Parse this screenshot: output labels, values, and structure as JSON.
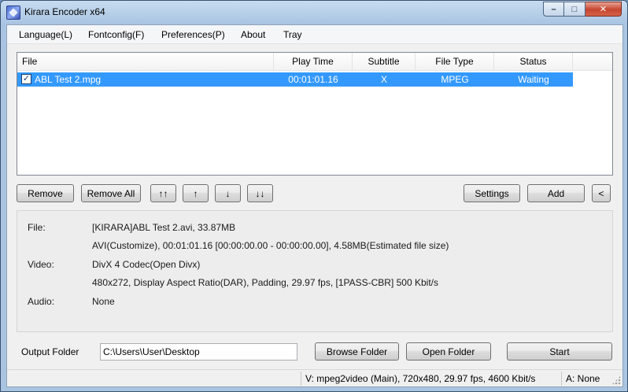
{
  "window": {
    "title": "Kirara Encoder x64",
    "controls": {
      "minimize": "–",
      "maximize": "□",
      "close": "✕"
    }
  },
  "menu": [
    {
      "label": "Language(L)"
    },
    {
      "label": "Fontconfig(F)"
    },
    {
      "label": "Preferences(P)"
    },
    {
      "label": "About"
    },
    {
      "label": "Tray"
    }
  ],
  "file_list": {
    "columns": [
      "File",
      "Play Time",
      "Subtitle",
      "File Type",
      "Status"
    ],
    "rows": [
      {
        "checked": true,
        "file": "ABL Test 2.mpg",
        "play_time": "00:01:01.16",
        "subtitle": "X",
        "file_type": "MPEG",
        "status": "Waiting"
      }
    ]
  },
  "toolbar": {
    "remove": "Remove",
    "remove_all": "Remove All",
    "move_top": "↑↑",
    "move_up": "↑",
    "move_down": "↓",
    "move_bottom": "↓↓",
    "settings": "Settings",
    "add": "Add",
    "collapse": "<"
  },
  "info": {
    "file_label": "File:",
    "file_line1": "[KIRARA]ABL Test 2.avi, 33.87MB",
    "file_line2": "AVI(Customize), 00:01:01.16 [00:00:00.00 - 00:00:00.00], 4.58MB(Estimated file size)",
    "video_label": "Video:",
    "video_line1": "DivX 4 Codec(Open Divx)",
    "video_line2": "480x272, Display Aspect Ratio(DAR), Padding, 29.97 fps, [1PASS-CBR] 500 Kbit/s",
    "audio_label": "Audio:",
    "audio_line1": "None"
  },
  "output": {
    "label": "Output Folder",
    "path": "C:\\Users\\User\\Desktop",
    "browse": "Browse Folder",
    "open": "Open Folder",
    "start": "Start"
  },
  "status_bar": {
    "video": "V: mpeg2video (Main), 720x480, 29.97 fps, 4600 Kbit/s",
    "audio": "A: None"
  },
  "colors": {
    "selection": "#3399ff",
    "title_bar": "#b9d1ea",
    "close_button": "#c6452e"
  }
}
